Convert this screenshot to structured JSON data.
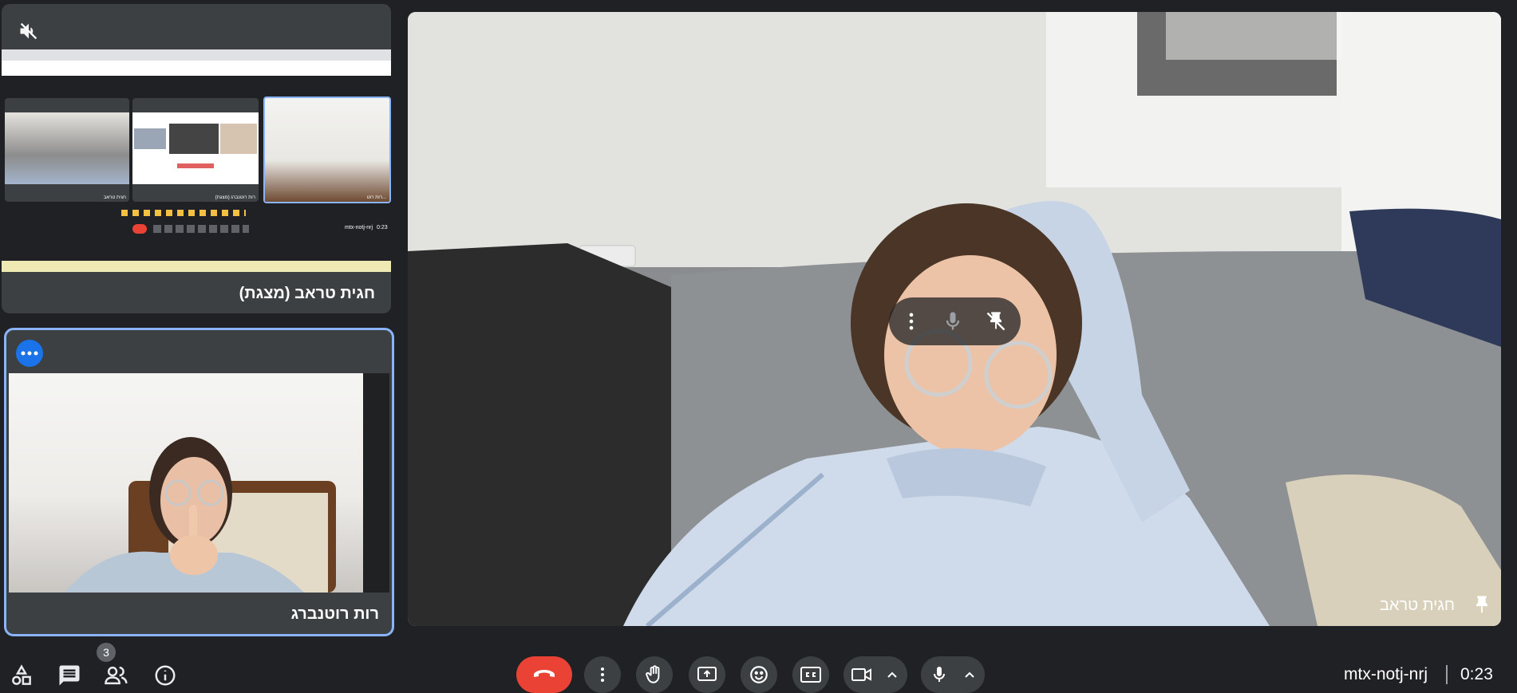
{
  "presentation_tile": {
    "presenter_name": "חגית טראב (מצגת)",
    "mini_meeting_code": "mtx-notj-nrj",
    "mini_timer": "0:23",
    "mini_tile_names": [
      "חגית טראב",
      "רות רוטנברג (מצגת)",
      "רות רוט..."
    ]
  },
  "self_tile": {
    "name": "רות רוטנברג"
  },
  "main_video": {
    "participant_name": "חגית טראב",
    "hover_menu": [
      "more-options",
      "microphone",
      "unpin"
    ]
  },
  "bottom_bar": {
    "meeting_code": "mtx-notj-nrj",
    "timer": "0:23",
    "participants_count": "3",
    "left_icons": [
      "activities-icon",
      "chat-icon",
      "people-icon",
      "info-icon"
    ],
    "controls": [
      "hang-up",
      "more-options",
      "raise-hand",
      "present-screen",
      "emoji",
      "captions",
      "camera",
      "camera-options",
      "microphone",
      "microphone-options"
    ]
  },
  "colors": {
    "background": "#202124",
    "tile": "#3c4043",
    "accent_blue": "#8ab4f8",
    "self_badge_blue": "#1a73e8",
    "hangup_red": "#ea4335"
  }
}
